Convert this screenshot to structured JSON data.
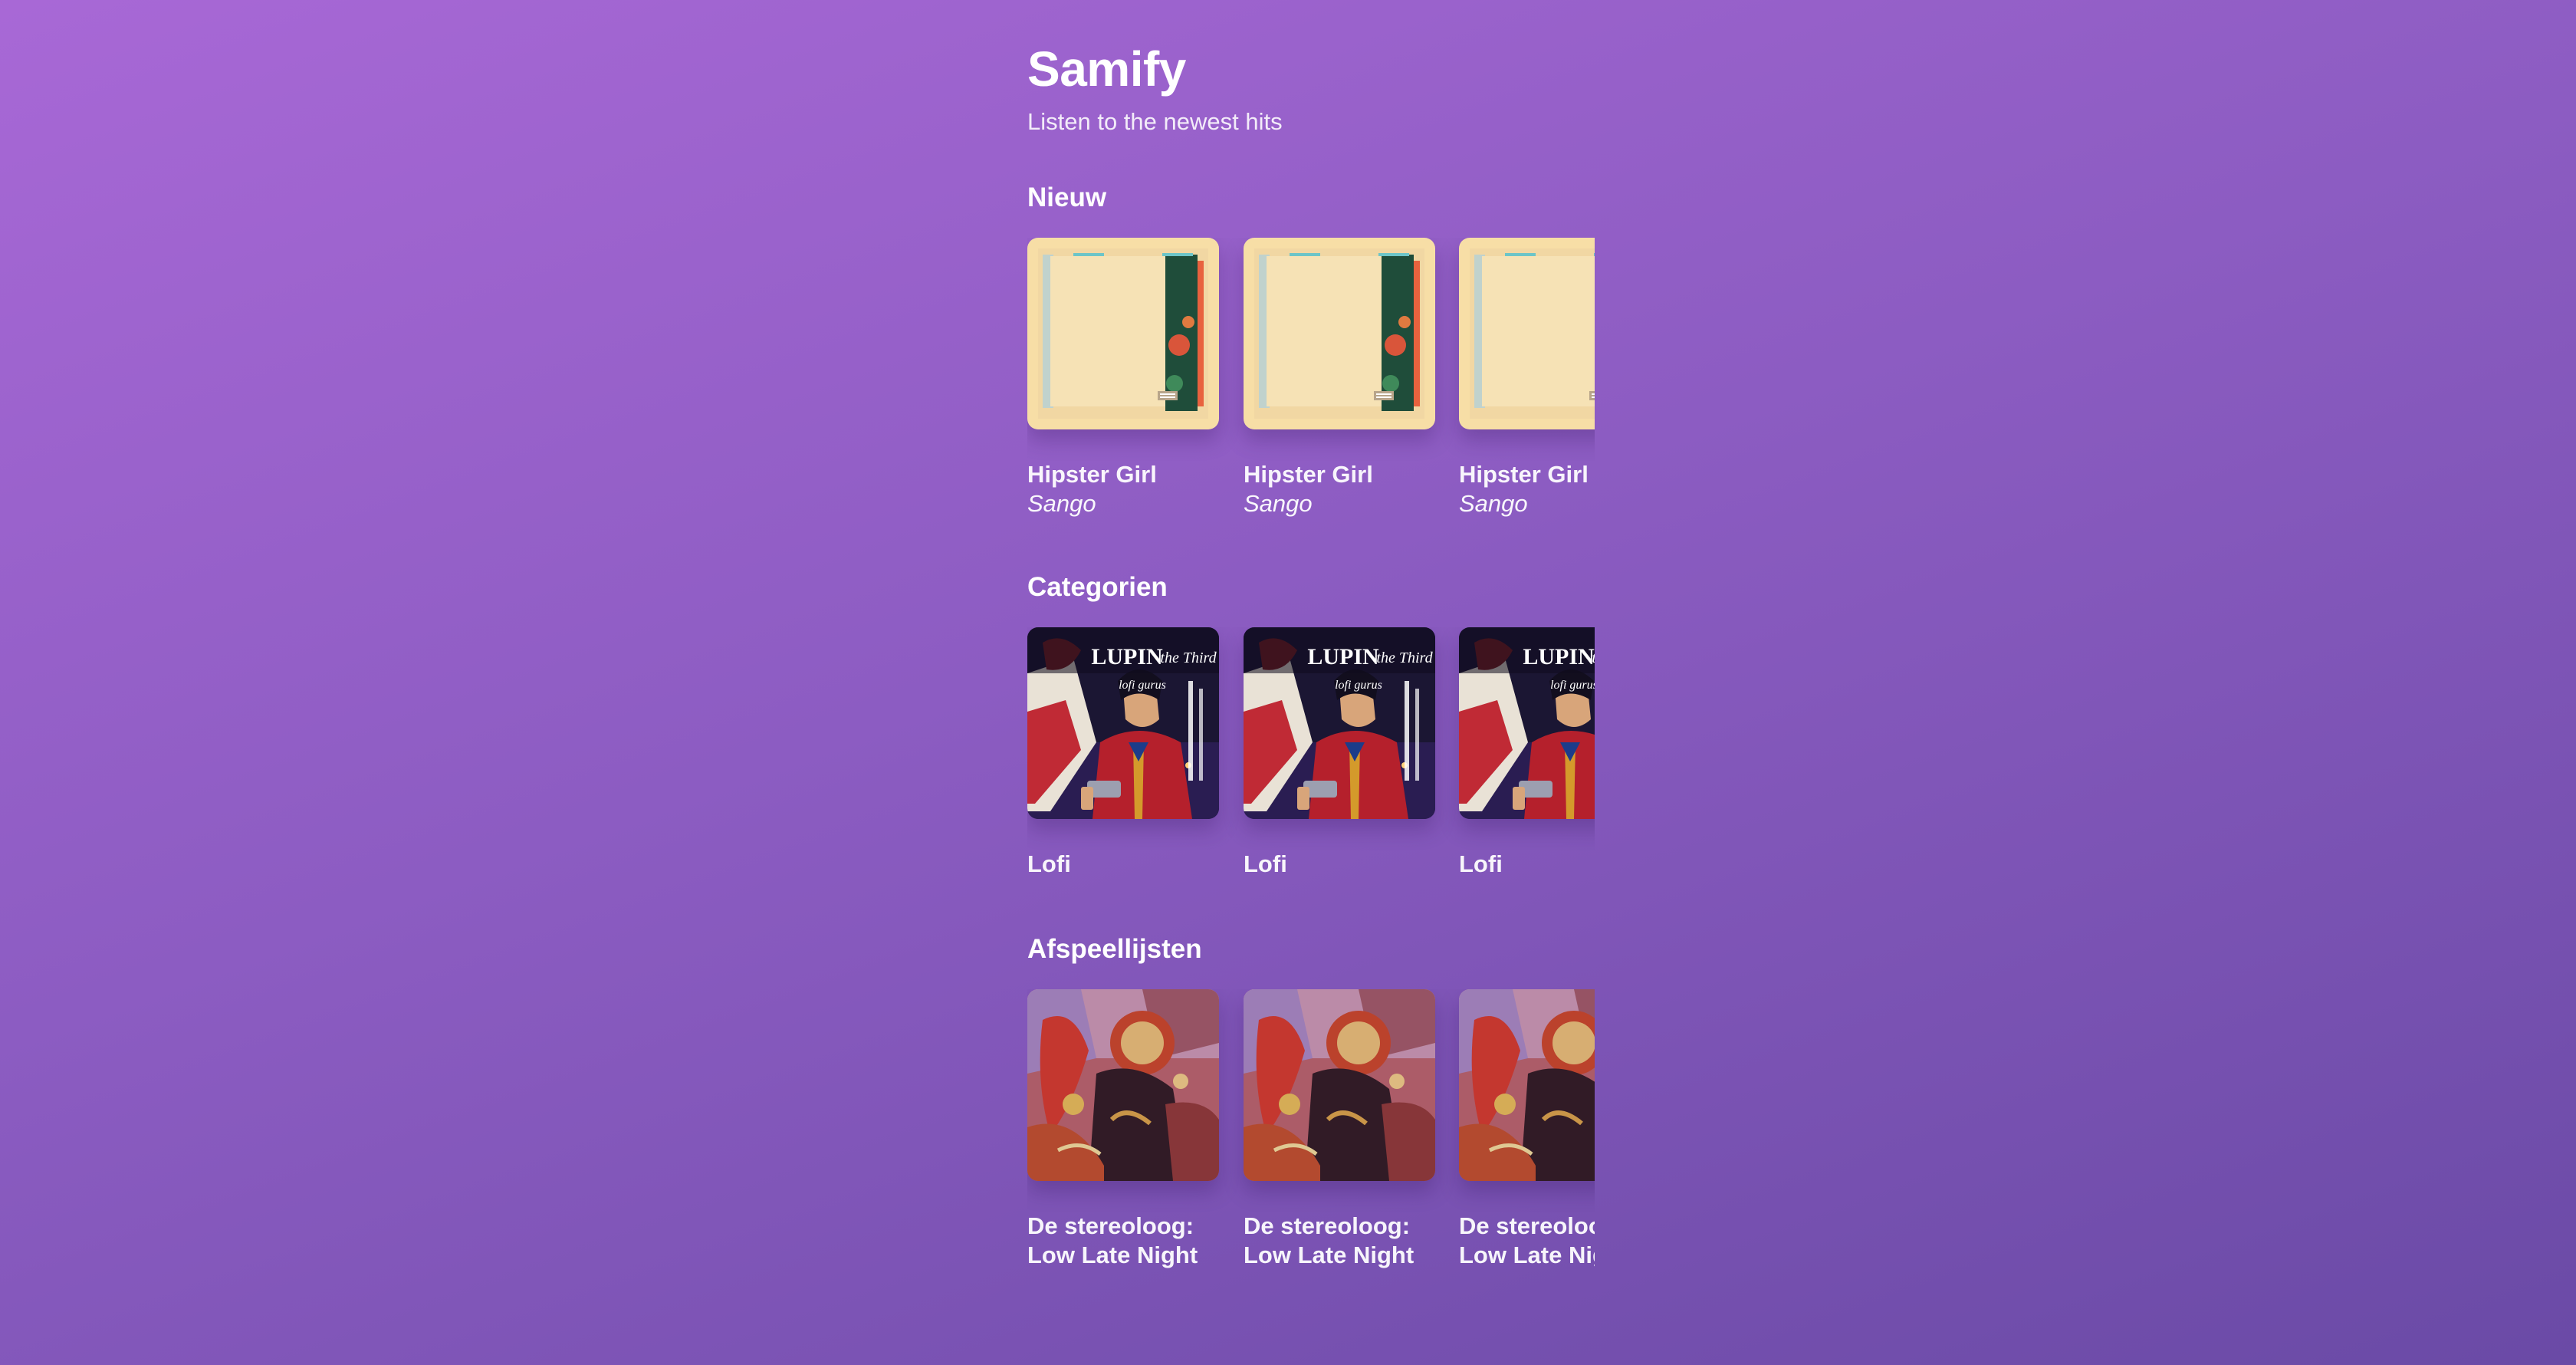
{
  "app": {
    "title": "Samify",
    "subtitle": "Listen to the newest hits"
  },
  "sections": {
    "new": {
      "title": "Nieuw",
      "cover_icon": "album-cover-hipster-girl",
      "items": [
        {
          "title": "Hipster Girl",
          "artist": "Sango"
        },
        {
          "title": "Hipster Girl",
          "artist": "Sango"
        },
        {
          "title": "Hipster Girl",
          "artist": "Sango"
        }
      ]
    },
    "categories": {
      "title": "Categorien",
      "cover_icon": "category-cover-lupin-the-third-lofi",
      "cover_text": {
        "line1": "LUPIN",
        "line2": "the Third",
        "line3": "lofi gurus"
      },
      "items": [
        {
          "title": "Lofi"
        },
        {
          "title": "Lofi"
        },
        {
          "title": "Lofi"
        }
      ]
    },
    "playlists": {
      "title": "Afspeellijsten",
      "cover_icon": "playlist-cover-psychedelic-art",
      "items": [
        {
          "title": "De stereoloog: Low Late Night"
        },
        {
          "title": "De stereoloog: Low Late Night"
        },
        {
          "title": "De stereoloog: Low Late Night"
        }
      ]
    }
  },
  "colors": {
    "background_start": "#a868d6",
    "background_end": "#6a4aa6",
    "text": "#ffffff"
  }
}
